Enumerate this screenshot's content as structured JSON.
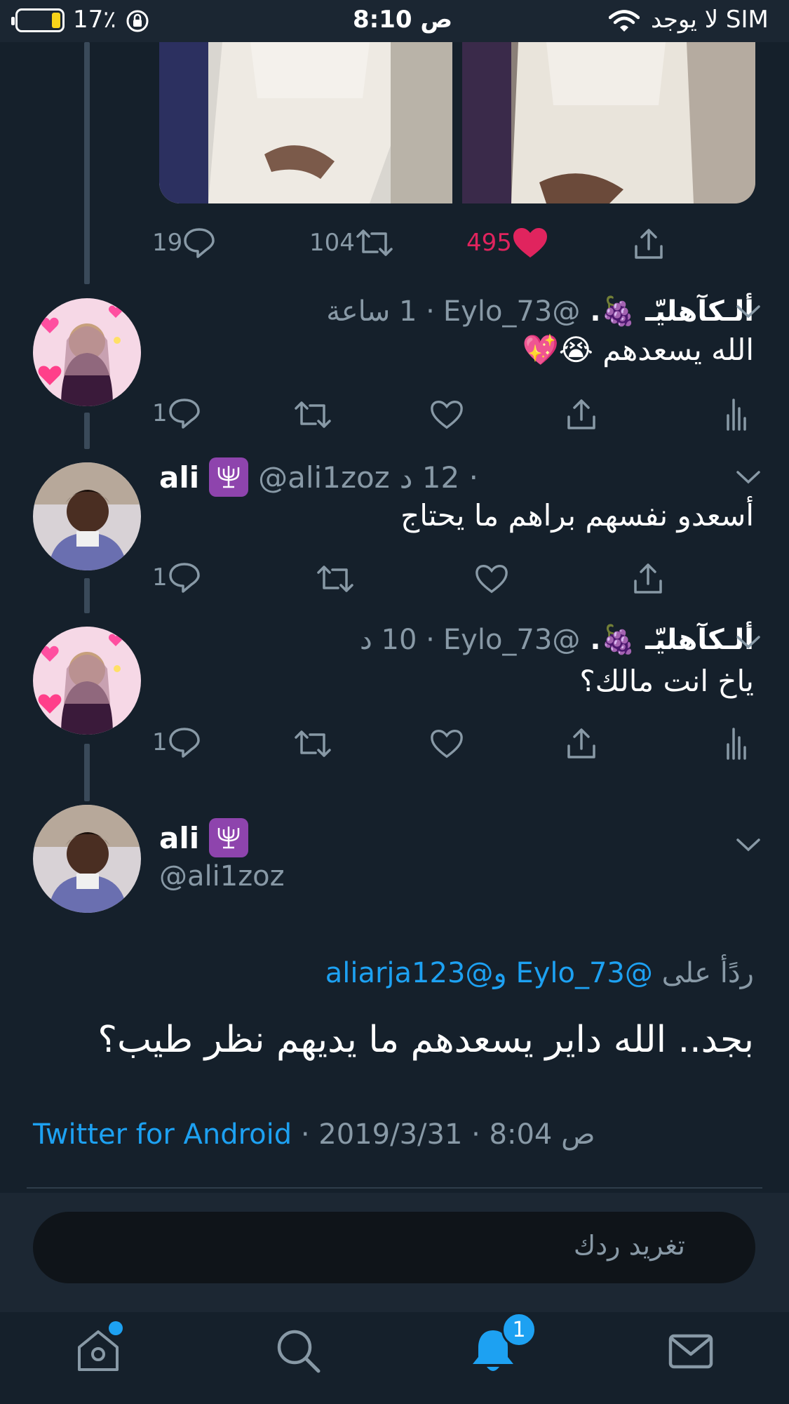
{
  "status_bar": {
    "battery": "17٪",
    "time": "8:10 ص",
    "carrier": "لا يوجد SIM",
    "battery_level": 0.17
  },
  "parent_tweet": {
    "replies": "19",
    "retweets": "104",
    "likes": "495"
  },
  "replies": [
    {
      "name": "ألـكآهليّـ 🍇.",
      "handle": "@Eylo_73",
      "time": "· 1 ساعة",
      "text": "الله يسعدهم 😭💖",
      "reply_count": "1"
    },
    {
      "name": "ali",
      "handle": "@ali1zoz",
      "time": "· 12 د",
      "text": "أسعدو نفسهم براهم ما يحتاج",
      "reply_count": "1"
    },
    {
      "name": "ألـكآهليّـ 🍇.",
      "handle": "@Eylo_73",
      "time": "· 10 د",
      "text": "ياخ انت مالك؟",
      "reply_count": "1"
    }
  ],
  "focused_tweet": {
    "name": "ali",
    "handle": "@ali1zoz",
    "reply_to_label": "ردًأ على",
    "reply_to_handles": "@Eylo_73 و@aliarja123",
    "text": "بجد.. الله داير يسعدهم ما يديهم نظر طيب؟",
    "source": "Twitter for Android",
    "date": "· 2019/3/31 · ص 8:04"
  },
  "compose": {
    "placeholder": "تغريد ردك"
  },
  "tab_bar": {
    "notification_badge": "1",
    "icons": [
      "home-icon",
      "search-icon",
      "notifications-icon",
      "messages-icon"
    ]
  },
  "colors": {
    "background": "#15202b",
    "accent": "#1da1f2",
    "like": "#e0245e",
    "muted": "#8899a6"
  }
}
